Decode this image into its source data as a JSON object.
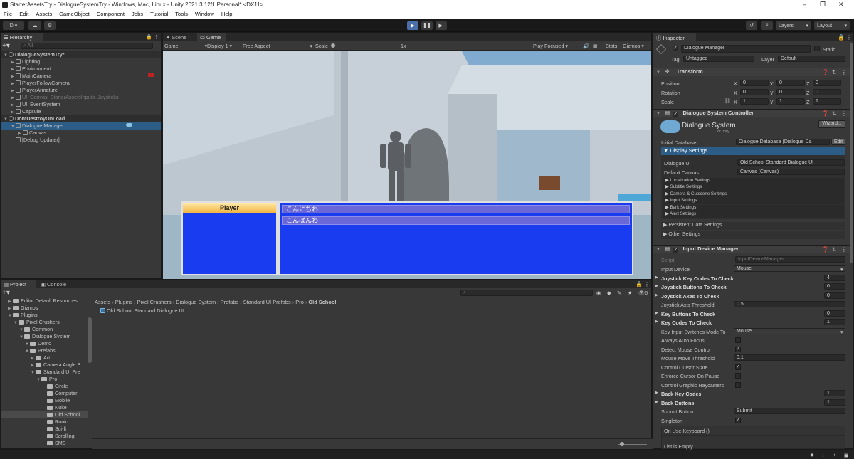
{
  "window": {
    "title": "StarterAssetsTry - DialogueSystemTry - Windows, Mac, Linux - Unity 2021.3.12f1 Personal* <DX11>",
    "controls": [
      "–",
      "❐",
      "✕"
    ]
  },
  "menu": [
    "File",
    "Edit",
    "Assets",
    "GameObject",
    "Component",
    "Jobs",
    "Tutorial",
    "Tools",
    "Window",
    "Help"
  ],
  "toolbar": {
    "account": "D ▾",
    "layers": "Layers",
    "layout": "Layout"
  },
  "hierarchy": {
    "tab": "Hierarchy",
    "search_placeholder": "All",
    "items": [
      {
        "label": "DialogueSystemTry*",
        "indent": 0,
        "scene": true
      },
      {
        "label": "Lighting",
        "indent": 1
      },
      {
        "label": "Environment",
        "indent": 1
      },
      {
        "label": "MainCamera",
        "indent": 1
      },
      {
        "label": "PlayerFollowCamera",
        "indent": 1
      },
      {
        "label": "PlayerArmature",
        "indent": 1
      },
      {
        "label": "UI_Canvas_StarterAssetsInputs_Joysticks",
        "indent": 1,
        "dim": true
      },
      {
        "label": "UI_EventSystem",
        "indent": 1
      },
      {
        "label": "Capsule",
        "indent": 1
      },
      {
        "label": "DontDestroyOnLoad",
        "indent": 0,
        "scene": true
      },
      {
        "label": "Dialogue Manager",
        "indent": 1,
        "selected": true
      },
      {
        "label": "Canvas",
        "indent": 2
      },
      {
        "label": "[Debug Updater]",
        "indent": 1
      }
    ]
  },
  "gameview": {
    "tabs": [
      "Scene",
      "Game"
    ],
    "display_mode": "Game",
    "display": "Display 1",
    "aspect": "Free Aspect",
    "scale_label": "Scale",
    "scale_value": "1x",
    "play_mode": "Play Focused",
    "stats": "Stats",
    "gizmos": "Gizmos",
    "dialogue": {
      "speaker": "Player",
      "responses": [
        "こんにちわ",
        "こんばんわ"
      ]
    }
  },
  "project": {
    "tabs": [
      "Project",
      "Console"
    ],
    "breadcrumb": [
      "Assets",
      "Plugins",
      "Pixel Crushers",
      "Dialogue System",
      "Prefabs",
      "Standard UI Prefabs",
      "Pro",
      "Old School"
    ],
    "asset": "Old School Standard Dialogue UI",
    "count_badge": "6",
    "tree": [
      {
        "label": "Editor Default Resources",
        "indent": 1
      },
      {
        "label": "Gizmos",
        "indent": 1
      },
      {
        "label": "Plugins",
        "indent": 1
      },
      {
        "label": "Pixel Crushers",
        "indent": 2
      },
      {
        "label": "Common",
        "indent": 3
      },
      {
        "label": "Dialogue System",
        "indent": 3
      },
      {
        "label": "Demo",
        "indent": 4
      },
      {
        "label": "Prefabs",
        "indent": 4
      },
      {
        "label": "Art",
        "indent": 5
      },
      {
        "label": "Camera Angle S",
        "indent": 5
      },
      {
        "label": "Standard UI Pre",
        "indent": 5
      },
      {
        "label": "Pro",
        "indent": 6
      },
      {
        "label": "Circle",
        "indent": 7
      },
      {
        "label": "Computer",
        "indent": 7
      },
      {
        "label": "Mobile",
        "indent": 7
      },
      {
        "label": "Nuke",
        "indent": 7
      },
      {
        "label": "Old School",
        "indent": 7,
        "selected": true
      },
      {
        "label": "Runic",
        "indent": 7
      },
      {
        "label": "Sci-fi",
        "indent": 7
      },
      {
        "label": "Scrolling",
        "indent": 7
      },
      {
        "label": "SMS",
        "indent": 7
      }
    ]
  },
  "inspector": {
    "tab": "Inspector",
    "object_name": "Dialogue Manager",
    "static_label": "Static",
    "tag_label": "Tag",
    "tag_value": "Untagged",
    "layer_label": "Layer",
    "layer_value": "Default",
    "transform": {
      "title": "Transform",
      "position": {
        "label": "Position",
        "x": "0",
        "y": "0",
        "z": "0"
      },
      "rotation": {
        "label": "Rotation",
        "x": "0",
        "y": "0",
        "z": "0"
      },
      "scale": {
        "label": "Scale",
        "x": "1",
        "y": "1",
        "z": "1"
      }
    },
    "dsc": {
      "title": "Dialogue System Controller",
      "logo_text": "Dialogue System",
      "logo_sub": "for unity",
      "wizard": "Wizard...",
      "initial_db_label": "Initial Database",
      "initial_db_value": "Dialogue Database (Dialogue Da",
      "edit": "Edit",
      "display_settings": "Display Settings",
      "dialogue_ui_label": "Dialogue UI",
      "dialogue_ui_value": "Old School Standard Dialogue UI",
      "default_canvas_label": "Default Canvas",
      "default_canvas_value": "Canvas (Canvas)",
      "sub_settings": [
        "Localization Settings",
        "Subtitle Settings",
        "Camera & Cutscene Settings",
        "Input Settings",
        "Bark Settings",
        "Alert Settings"
      ],
      "persistent": "Persistent Data Settings",
      "other": "Other Settings"
    },
    "idm": {
      "title": "Input Device Manager",
      "script_label": "Script",
      "script_value": "InputDeviceManager",
      "rows": [
        {
          "label": "Input Device",
          "value": "Mouse",
          "kind": "dropdown"
        },
        {
          "label": "Joystick Key Codes To Check",
          "value": "4",
          "kind": "num",
          "bold": true
        },
        {
          "label": "Joystick Buttons To Check",
          "value": "0",
          "kind": "num",
          "bold": true
        },
        {
          "label": "Joystick Axes To Check",
          "value": "0",
          "kind": "num",
          "bold": true
        },
        {
          "label": "Joystick Axis Threshold",
          "value": "0.5",
          "kind": "field"
        },
        {
          "label": "Key Buttons To Check",
          "value": "0",
          "kind": "num",
          "bold": true
        },
        {
          "label": "Key Codes To Check",
          "value": "1",
          "kind": "num",
          "bold": true
        },
        {
          "label": "Key Input Switches Mode To",
          "value": "Mouse",
          "kind": "dropdown"
        },
        {
          "label": "Always Auto Focus",
          "value": "",
          "kind": "check"
        },
        {
          "label": "Detect Mouse Control",
          "value": "✓",
          "kind": "check"
        },
        {
          "label": "Mouse Move Threshold",
          "value": "0.1",
          "kind": "field"
        },
        {
          "label": "Control Cursor State",
          "value": "✓",
          "kind": "check"
        },
        {
          "label": "Enforce Cursor On Pause",
          "value": "",
          "kind": "check"
        },
        {
          "label": "Control Graphic Raycasters",
          "value": "",
          "kind": "check"
        },
        {
          "label": "Back Key Codes",
          "value": "1",
          "kind": "num",
          "bold": true
        },
        {
          "label": "Back Buttons",
          "value": "1",
          "kind": "num",
          "bold": true
        },
        {
          "label": "Submit Button",
          "value": "Submit",
          "kind": "field"
        },
        {
          "label": "Singleton",
          "value": "✓",
          "kind": "check"
        }
      ],
      "on_use_keyboard": "On Use Keyboard ()",
      "list_empty": "List is Empty"
    }
  }
}
